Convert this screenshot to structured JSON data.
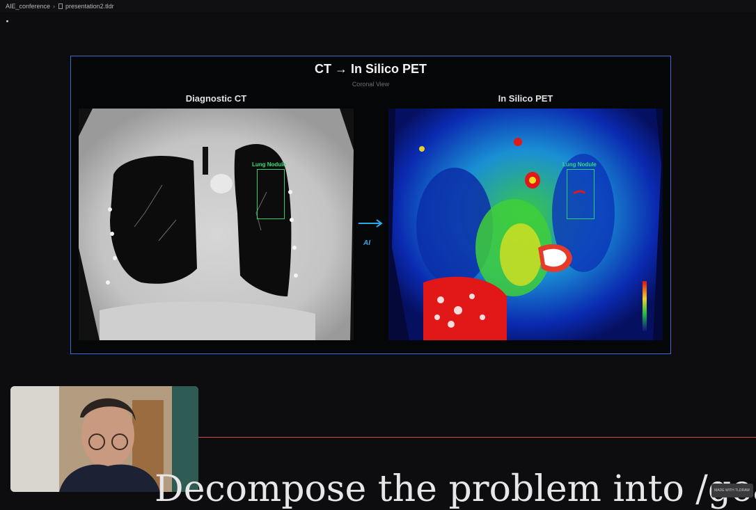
{
  "breadcrumb": {
    "folder": "AIE_conference",
    "file": "presentation2.tldr"
  },
  "slide": {
    "title": "CT  →  In Silico PET",
    "subtitle": "Coronal View",
    "left_panel": {
      "title": "Diagnostic CT",
      "annotation": "Lung Nodule"
    },
    "right_panel": {
      "title": "In Silico PET",
      "annotation": "Lung Nodule"
    },
    "arrow_label": "AI"
  },
  "caption": {
    "text": "Decompose the problem into   /goal"
  },
  "watermark": {
    "text": "MADE WITH TLDRAW"
  },
  "colors": {
    "frame": "#3d6bd6",
    "nodule": "#2ee07a",
    "arrow": "#2aa8e8",
    "divider": "#c94a4a"
  }
}
